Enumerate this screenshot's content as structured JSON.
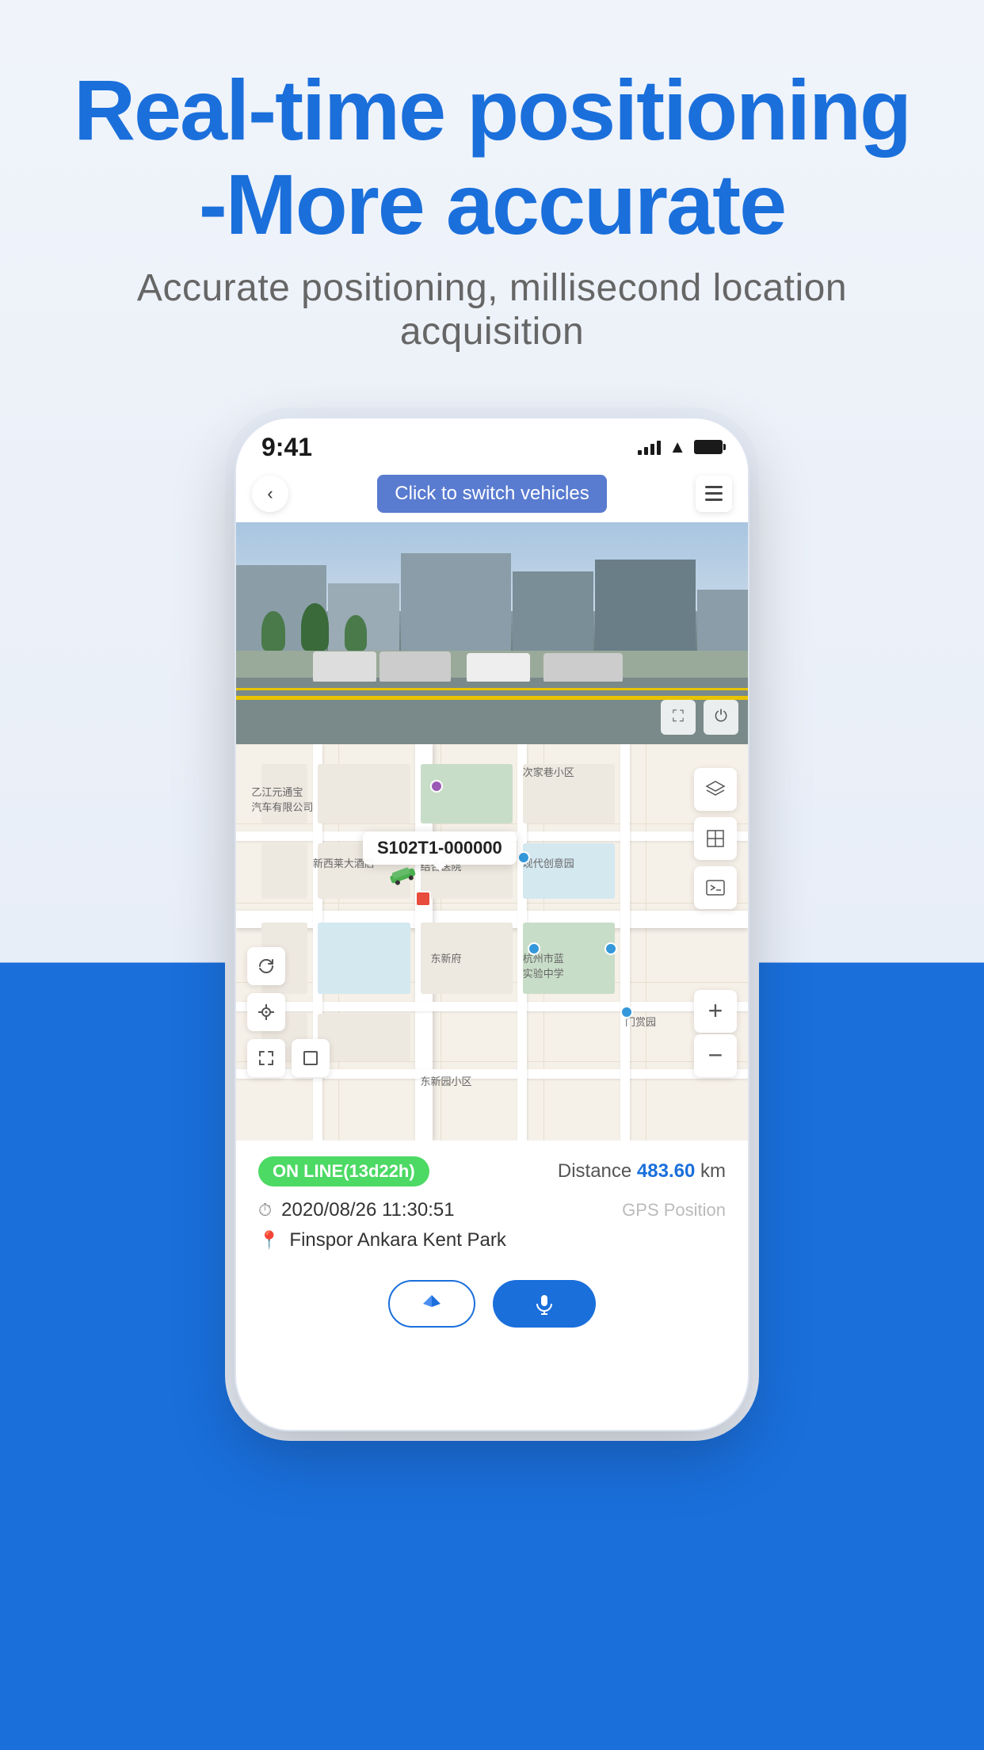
{
  "page": {
    "background_top": "#f0f4fa",
    "background_bottom": "#1a6fdb"
  },
  "header": {
    "title_line1": "Real-time positioning",
    "title_line2": "-More accurate",
    "subtitle": "Accurate positioning, millisecond location acquisition"
  },
  "phone": {
    "status_bar": {
      "time": "9:41"
    },
    "nav": {
      "switch_label": "Click to switch vehicles",
      "back_arrow": "‹",
      "menu_icon": "menu"
    },
    "street_view": {
      "expand_icon": "⛶",
      "power_icon": "⏻"
    },
    "map": {
      "vehicle_id": "S102T1-000000",
      "layer_icon": "⊛",
      "grid_icon": "⊞",
      "terminal_icon": ">_",
      "zoom_in": "+",
      "zoom_out": "−",
      "refresh_icon": "↻",
      "crosshair_icon": "⊕",
      "expand_icon": "⛶",
      "fullscreen_icon": "⛶"
    },
    "info_panel": {
      "online_status": "ON LINE(13d22h)",
      "distance_label": "Distance",
      "distance_value": "483.60",
      "distance_unit": "km",
      "datetime": "2020/08/26 11:30:51",
      "gps_label": "GPS Position",
      "location": "Finspor Ankara Kent Park",
      "clock_icon": "🕐",
      "pin_icon": "📍"
    },
    "action_buttons": {
      "navigate_icon": "➤",
      "mic_icon": "🎤"
    }
  }
}
